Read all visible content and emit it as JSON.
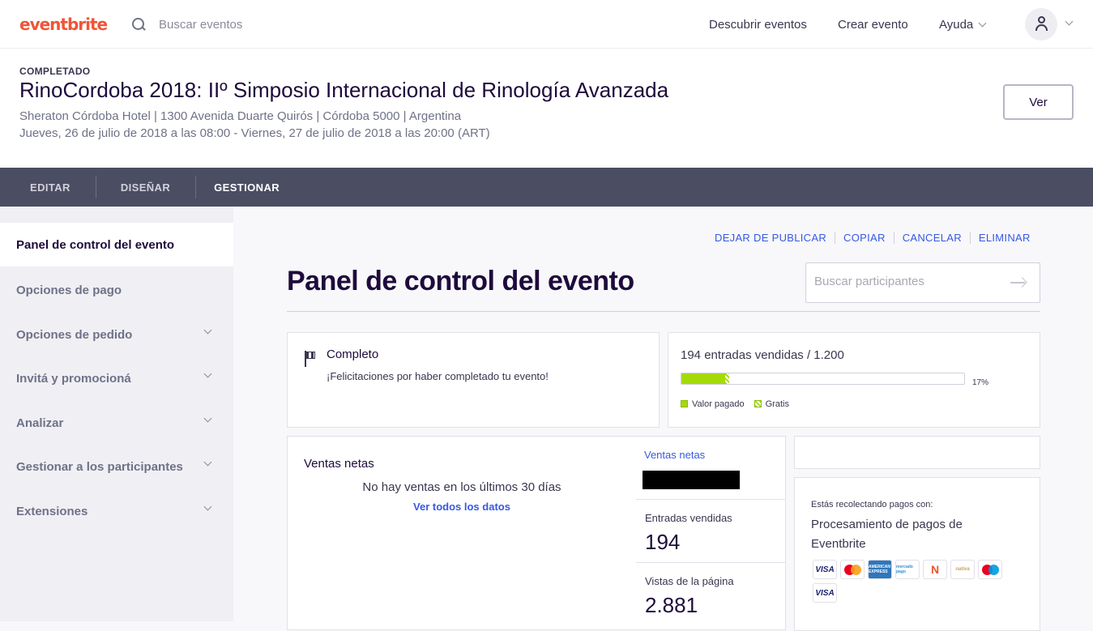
{
  "topnav": {
    "logo": "eventbrite",
    "search_placeholder": "Buscar eventos",
    "discover": "Descubrir eventos",
    "create": "Crear evento",
    "help": "Ayuda"
  },
  "event": {
    "status": "COMPLETADO",
    "title": "RinoCordoba 2018: IIº Simposio Internacional de Rinología Avanzada",
    "venue": "Sheraton Córdoba Hotel | 1300 Avenida Duarte Quirós | Córdoba 5000 | Argentina",
    "date": "Jueves, 26 de julio de 2018 a las 08:00 - Viernes, 27 de julio de 2018 a las 20:00 (ART)",
    "view_button": "Ver"
  },
  "tabs": [
    "EDITAR",
    "DISEÑAR",
    "GESTIONAR"
  ],
  "sidebar": {
    "items": [
      {
        "label": "Panel de control del evento"
      },
      {
        "label": "Opciones de pago"
      },
      {
        "label": "Opciones de pedido"
      },
      {
        "label": "Invitá y promocioná"
      },
      {
        "label": "Analizar"
      },
      {
        "label": "Gestionar a los participantes"
      },
      {
        "label": "Extensiones"
      }
    ]
  },
  "actions": [
    "DEJAR DE PUBLICAR",
    "COPIAR",
    "CANCELAR",
    "ELIMINAR"
  ],
  "main": {
    "title": "Panel de control del evento",
    "search_placeholder": "Buscar participantes"
  },
  "completed_card": {
    "title": "Completo",
    "subtitle": "¡Felicitaciones por haber completado tu evento!"
  },
  "tickets_card": {
    "title": "194 entradas vendidas / 1.200",
    "progress_percent": 17,
    "progress_label": "17%",
    "legend_paid": "Valor pagado",
    "legend_free": "Gratis",
    "paid_color": "#a5da0a"
  },
  "net_sales_card": {
    "title": "Ventas netas",
    "empty_message": "No hay ventas en los últimos 30 días",
    "view_all": "Ver todos los datos"
  },
  "stats": {
    "net_sales_link": "Ventas netas",
    "tickets_sold_label": "Entradas vendidas",
    "tickets_sold_value": "194",
    "page_views_label": "Vistas de la página",
    "page_views_value": "2.881"
  },
  "payments_card": {
    "label": "Estás recolectando pagos con:",
    "title": "Procesamiento de pagos de Eventbrite",
    "logos": [
      "visa",
      "mastercard",
      "american-express",
      "mercado-pago",
      "naranja",
      "nativa",
      "maestro",
      "visa"
    ],
    "logo_text": {
      "visa": "VISA",
      "amex": "AMERICAN EXPRESS",
      "mercado_pago": "mercado pago",
      "naranja": "N",
      "nativa": "nativa"
    }
  },
  "colors": {
    "brand": "#f05537",
    "link": "#3659e3",
    "tabbar": "#4b4d63"
  }
}
